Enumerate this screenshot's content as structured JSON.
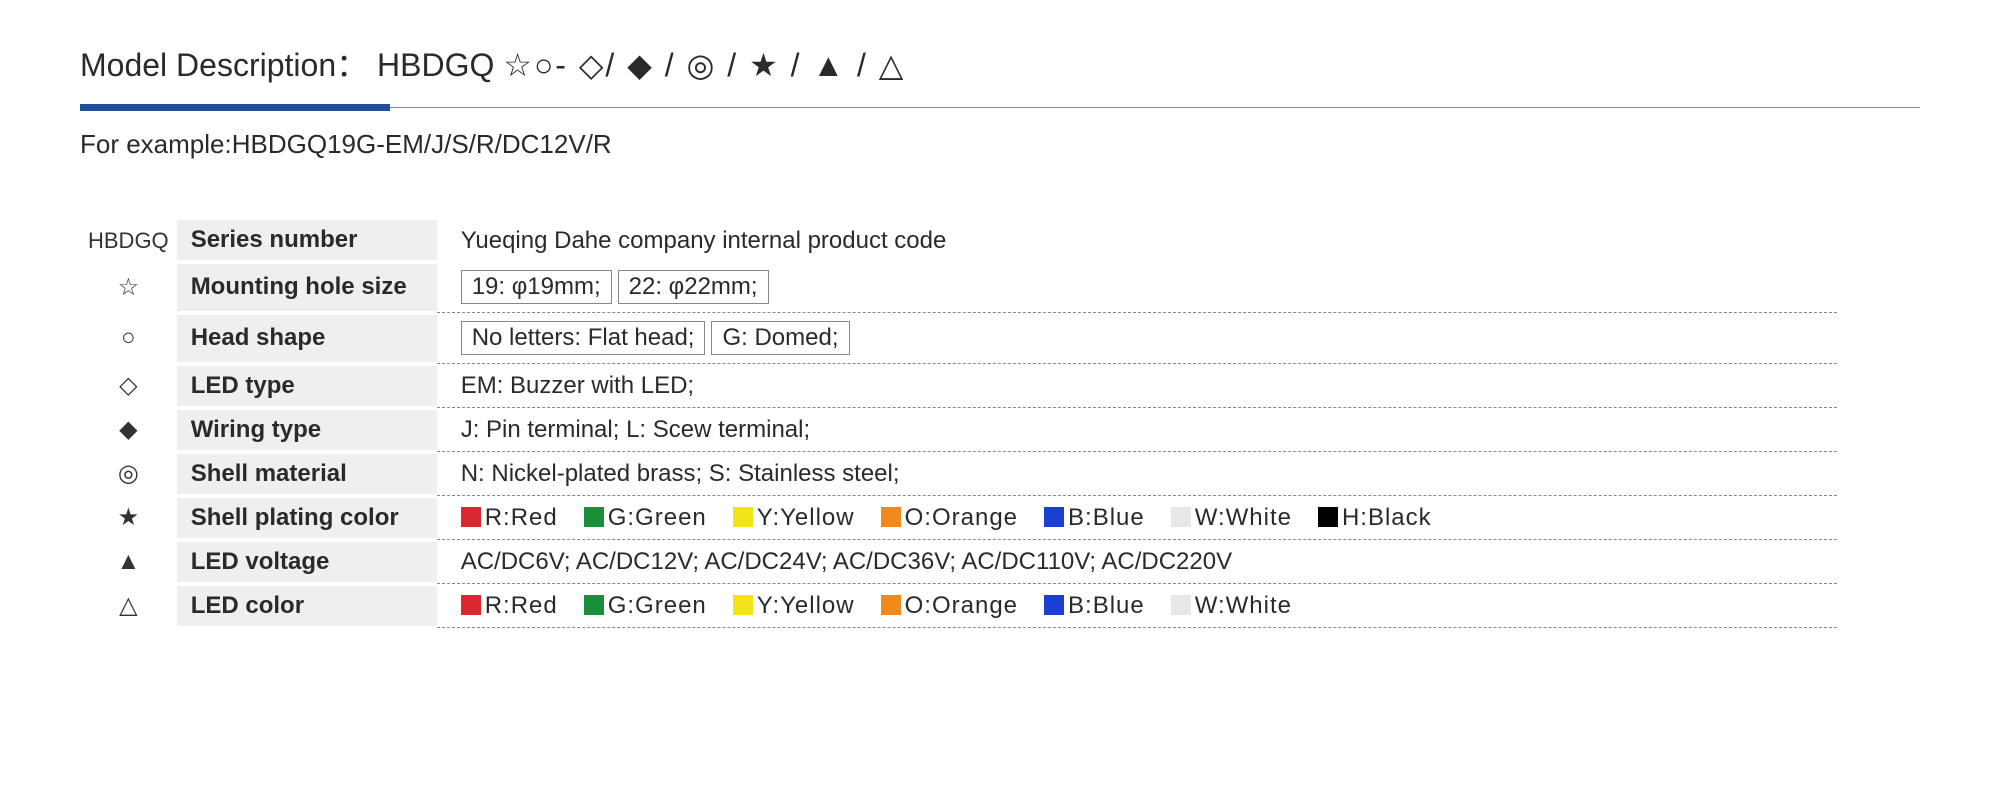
{
  "title": {
    "label": "Model Description：",
    "code_prefix": "HBDGQ",
    "symbols": "☆○- ◇/ ◆ / ◎ / ★ / ▲ / △"
  },
  "example": "For example:HBDGQ19G-EM/J/S/R/DC12V/R",
  "rows": [
    {
      "symbol": "HBDGQ",
      "label": "Series number",
      "value": "Yueqing Dahe company internal product code",
      "boxed_values": [],
      "colors": []
    },
    {
      "symbol_class": "sym-star-outline",
      "label": "Mounting hole size",
      "value": "",
      "boxed_values": [
        "19: φ19mm;",
        "22: φ22mm;"
      ],
      "colors": []
    },
    {
      "symbol_class": "sym-circle-outline",
      "label": "Head  shape",
      "value": "",
      "boxed_values": [
        "No letters: Flat head;",
        "G: Domed;"
      ],
      "colors": []
    },
    {
      "symbol_class": "sym-diamond-outline",
      "label": "LED type",
      "value": "EM: Buzzer with LED;",
      "boxed_values": [],
      "colors": []
    },
    {
      "symbol_class": "sym-diamond-filled",
      "label": "Wiring type",
      "value": "J: Pin terminal;   L: Scew terminal;",
      "boxed_values": [],
      "colors": []
    },
    {
      "symbol_class": "sym-double-circle",
      "label": "Shell material",
      "value": "N: Nickel-plated brass;   S: Stainless steel;",
      "boxed_values": [],
      "colors": []
    },
    {
      "symbol_class": "sym-star-filled",
      "label": "Shell plating color",
      "value": "",
      "boxed_values": [],
      "colors": [
        {
          "hex": "#d9272e",
          "label": "R:Red"
        },
        {
          "hex": "#1a8f3a",
          "label": "G:Green"
        },
        {
          "hex": "#f4e21a",
          "label": "Y:Yellow"
        },
        {
          "hex": "#f08a1a",
          "label": "O:Orange"
        },
        {
          "hex": "#1a3fd1",
          "label": "B:Blue"
        },
        {
          "hex": "#e8e8e8",
          "label": "W:White"
        },
        {
          "hex": "#000000",
          "label": "H:Black"
        }
      ]
    },
    {
      "symbol_class": "sym-triangle-filled",
      "label": "LED voltage",
      "value": "AC/DC6V;   AC/DC12V;   AC/DC24V;   AC/DC36V;   AC/DC110V;   AC/DC220V",
      "boxed_values": [],
      "colors": []
    },
    {
      "symbol_class": "sym-triangle-outline",
      "label": "LED color",
      "value": "",
      "boxed_values": [],
      "colors": [
        {
          "hex": "#d9272e",
          "label": "R:Red"
        },
        {
          "hex": "#1a8f3a",
          "label": "G:Green"
        },
        {
          "hex": "#f4e21a",
          "label": "Y:Yellow"
        },
        {
          "hex": "#f08a1a",
          "label": "O:Orange"
        },
        {
          "hex": "#1a3fd1",
          "label": "B:Blue"
        },
        {
          "hex": "#e8e8e8",
          "label": "W:White"
        }
      ]
    }
  ]
}
